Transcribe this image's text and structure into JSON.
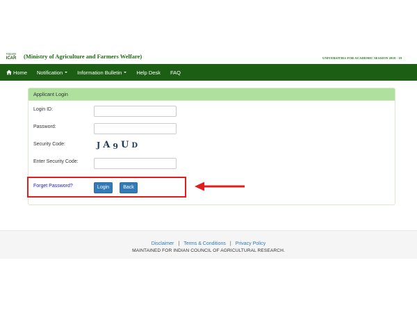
{
  "header": {
    "logo_top": "भाकृअनुप",
    "logo_text": "ICAR",
    "ministry": "(Ministry of Agriculture and Farmers Welfare)",
    "session": "UNIVERSITIES FOR ACADEMIC SESSION 2018 - 19"
  },
  "nav": {
    "home": "Home",
    "notification": "Notification",
    "bulletin": "Information Bulletin",
    "helpdesk": "Help Desk",
    "faq": "FAQ"
  },
  "login": {
    "title": "Applicant Login",
    "login_id_label": "Login ID:",
    "login_id_value": "",
    "password_label": "Password:",
    "password_value": "",
    "security_code_label": "Security Code:",
    "captcha": [
      "J",
      "A",
      "9",
      "U",
      "D"
    ],
    "enter_code_label": "Enter Security Code:",
    "enter_code_value": "",
    "forgot": "Forget Password?",
    "login_button": "Login",
    "back_button": "Back"
  },
  "annotation": {
    "highlight_color": "#e11d1d"
  },
  "footer": {
    "disclaimer": "Disclaimer",
    "separator": "|",
    "terms": "Terms & Conditions",
    "privacy": "Privacy Policy",
    "note": "MAINTAINED FOR INDIAN COUNCIL OF AGRICULTURAL RESEARCH."
  }
}
